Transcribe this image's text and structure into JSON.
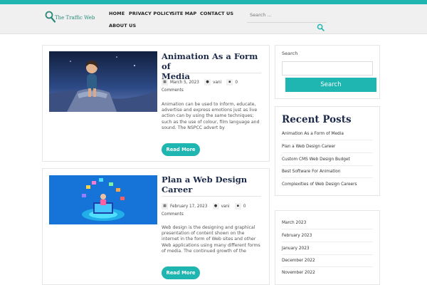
{
  "colors": {
    "accent": "#1fb5b0",
    "title": "#1c2a4a"
  },
  "site": {
    "logo_text": "The Traffic Web"
  },
  "nav": [
    "HOME",
    "PRIVACY POLICY",
    "SITE MAP",
    "CONTACT US",
    "ABOUT US"
  ],
  "header_search": {
    "placeholder": "Search ...",
    "icon": "search-icon"
  },
  "posts": [
    {
      "title_line1": "Animation As a Form of",
      "title_line2": "Media",
      "date": "March 5, 2023",
      "author": "vani",
      "comments": "0",
      "comments_label": "Comments",
      "excerpt": "Animation can be used to inform, educate, advertise and express emotions just as live action can by using the same techniques; such as the use of colour, film language and sound. The NSPCC advert by",
      "more_label": "Read More"
    },
    {
      "title_line1": "Plan a Web Design",
      "title_line2": "Career",
      "date": "February 17, 2023",
      "author": "vani",
      "comments": "0",
      "comments_label": "Comments",
      "excerpt": "Web design is the designing and graphical presentation of content shown on the internet in the form of Web sites and other Web applications using many different forms of media. The continued growth of the",
      "more_label": "Read More"
    }
  ],
  "sidebar": {
    "search_label": "Search",
    "search_button": "Search",
    "recent_title": "Recent Posts",
    "recent_posts": [
      "Animation As a Form of Media",
      "Plan a Web Design Career",
      "Custom CMS Web Design Budget",
      "Best Software For Animation",
      "Complexities of Web Design Careers"
    ],
    "archives": [
      "March 2023",
      "February 2023",
      "January 2023",
      "December 2022",
      "November 2022"
    ]
  }
}
